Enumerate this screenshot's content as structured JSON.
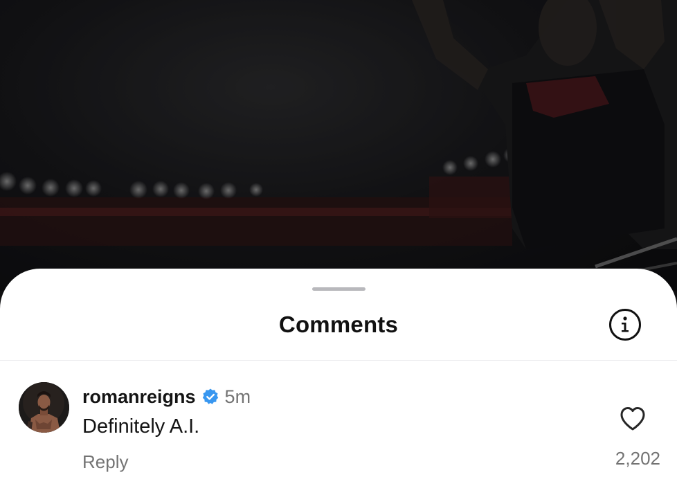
{
  "sheet": {
    "title": "Comments",
    "info_icon": "info-circle-icon"
  },
  "comments": [
    {
      "username": "romanreigns",
      "verified": true,
      "time": "5m",
      "text": "Definitely A.I.",
      "reply_label": "Reply",
      "like_icon": "heart-outline-icon",
      "like_count": "2,202"
    }
  ],
  "colors": {
    "verified_badge": "#3897f0",
    "secondary_text": "#737373",
    "primary_text": "#141414",
    "sheet_bg": "#ffffff"
  }
}
